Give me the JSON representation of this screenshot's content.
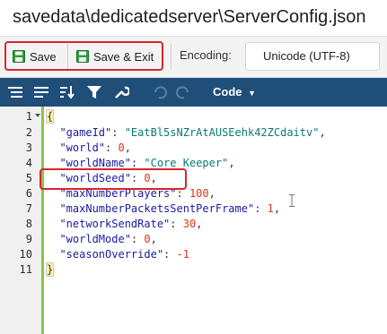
{
  "window": {
    "title": "savedata\\dedicatedserver\\ServerConfig.json"
  },
  "toolbar": {
    "save_label": "Save",
    "save_exit_label": "Save & Exit",
    "encoding_label": "Encoding:",
    "encoding_value": "Unicode (UTF-8)"
  },
  "editor_toolbar": {
    "code_label": "Code"
  },
  "editor": {
    "line_numbers": [
      "1",
      "2",
      "3",
      "4",
      "5",
      "6",
      "7",
      "8",
      "9",
      "10",
      "11"
    ],
    "lines": [
      {
        "open": "{"
      },
      {
        "key": "\"gameId\"",
        "sep": ": ",
        "val": "\"EatBl5sNZrAtAUSEehk42ZCdaitv\"",
        "end": ","
      },
      {
        "key": "\"world\"",
        "sep": ": ",
        "val": "0",
        "end": ","
      },
      {
        "key": "\"worldName\"",
        "sep": ": ",
        "val": "\"Core Keeper\"",
        "end": ","
      },
      {
        "key": "\"worldSeed\"",
        "sep": ": ",
        "val": "0",
        "end": ","
      },
      {
        "key": "\"maxNumberPlayers\"",
        "sep": ": ",
        "val": "100",
        "end": ","
      },
      {
        "key": "\"maxNumberPacketsSentPerFrame\"",
        "sep": ": ",
        "val": "1",
        "end": ","
      },
      {
        "key": "\"networkSendRate\"",
        "sep": ": ",
        "val": "30",
        "end": ","
      },
      {
        "key": "\"worldMode\"",
        "sep": ": ",
        "val": "0",
        "end": ","
      },
      {
        "key": "\"seasonOverride\"",
        "sep": ": ",
        "val": "-1",
        "end": ""
      },
      {
        "close": "}"
      }
    ]
  },
  "colors": {
    "toolbar_blue": "#1f4e79",
    "highlight_red": "#d8262c",
    "fold_green": "#8cc63f"
  }
}
